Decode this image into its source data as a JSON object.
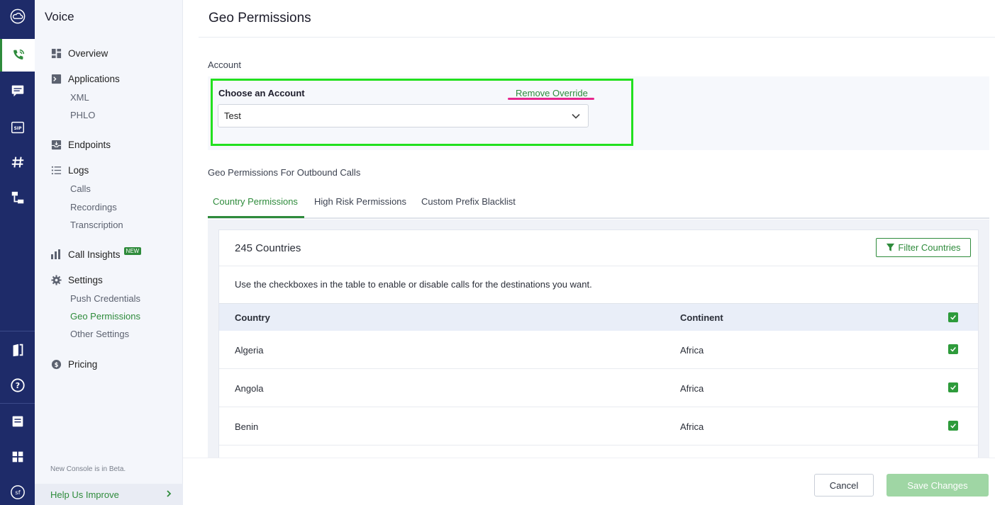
{
  "colors": {
    "rail": "#1e2b69",
    "accent": "#2e8b3b",
    "highlight_box": "#22e01f",
    "remove_underline": "#e7268d",
    "save_disabled": "#9fd6a4"
  },
  "rail": {
    "icons": [
      "cloud-logo-icon",
      "voice-phone-icon",
      "messaging-icon",
      "sip-icon",
      "number-hash-icon",
      "phlo-flow-icon",
      "docs-book-icon",
      "help-question-icon",
      "support-ticket-icon",
      "apps-grid-icon",
      "user-avatar-icon"
    ],
    "avatar_text": "sf"
  },
  "sidebar": {
    "title": "Voice",
    "items": [
      {
        "label": "Overview",
        "icon": "dashboard-icon"
      },
      {
        "label": "Applications",
        "icon": "terminal-icon",
        "subitems": [
          "XML",
          "PHLO"
        ]
      },
      {
        "label": "Endpoints",
        "icon": "inbox-icon"
      },
      {
        "label": "Logs",
        "icon": "list-icon",
        "subitems": [
          "Calls",
          "Recordings",
          "Transcription"
        ]
      },
      {
        "label": "Call Insights",
        "icon": "bar-chart-icon",
        "badge": "NEW"
      },
      {
        "label": "Settings",
        "icon": "gear-icon",
        "subitems": [
          "Push Credentials",
          "Geo Permissions",
          "Other Settings"
        ],
        "active_sub": "Geo Permissions"
      },
      {
        "label": "Pricing",
        "icon": "dollar-icon"
      }
    ],
    "beta_note": "New Console is in Beta.",
    "help_label": "Help Us Improve"
  },
  "page": {
    "title": "Geo Permissions",
    "account_section": "Account",
    "choose_label": "Choose an Account",
    "remove_override": "Remove Override",
    "account_value": "Test",
    "outbound_section": "Geo Permissions For Outbound Calls",
    "tabs": [
      "Country Permissions",
      "High Risk Permissions",
      "Custom Prefix Blacklist"
    ],
    "active_tab": "Country Permissions"
  },
  "table": {
    "count_label": "245 Countries",
    "filter_label": "Filter Countries",
    "help_text": "Use the checkboxes in the table to enable or disable calls for the destinations you want.",
    "columns": [
      "Country",
      "Continent"
    ],
    "header_checked": true,
    "rows": [
      {
        "country": "Algeria",
        "continent": "Africa",
        "checked": true
      },
      {
        "country": "Angola",
        "continent": "Africa",
        "checked": true
      },
      {
        "country": "Benin",
        "continent": "Africa",
        "checked": true
      }
    ]
  },
  "footer": {
    "cancel_label": "Cancel",
    "save_label": "Save Changes"
  }
}
